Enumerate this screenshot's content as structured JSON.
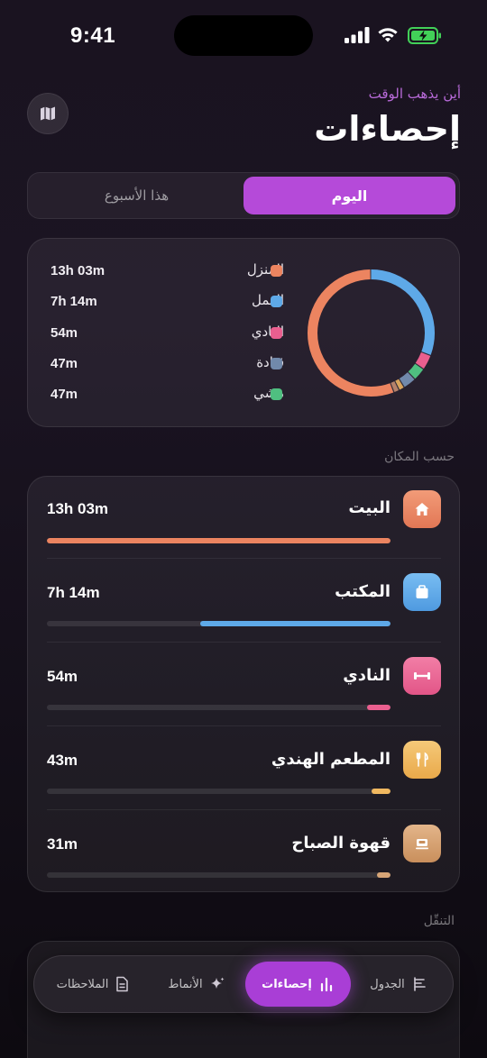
{
  "status_bar": {
    "time": "9:41"
  },
  "header": {
    "subtitle": "أين يذهب الوقت",
    "title": "إحصاءات",
    "map_icon": "map-icon"
  },
  "segmented": {
    "active": "اليوم",
    "inactive": "هذا الأسبوع"
  },
  "summary": {
    "items": [
      {
        "label": "المنزل",
        "value": "13h 03m",
        "color": "#ec8460"
      },
      {
        "label": "العمل",
        "value": "7h 14m",
        "color": "#5ea9e8"
      },
      {
        "label": "النادي",
        "value": "54m",
        "color": "#ea5f8f"
      },
      {
        "label": "قيادة",
        "value": "47m",
        "color": "#7189ab"
      },
      {
        "label": "مشي",
        "value": "47m",
        "color": "#4fbf80"
      }
    ]
  },
  "by_place": {
    "label": "حسب المكان",
    "items": [
      {
        "name": "البيت",
        "value": "13h 03m",
        "fraction": 1.0,
        "color": "#ec8460",
        "icon": "house-icon"
      },
      {
        "name": "المكتب",
        "value": "7h 14m",
        "fraction": 0.555,
        "color": "#5ea9e8",
        "icon": "briefcase-icon"
      },
      {
        "name": "النادي",
        "value": "54m",
        "fraction": 0.069,
        "color": "#ea5f8f",
        "icon": "dumbbell-icon"
      },
      {
        "name": "المطعم الهندي",
        "value": "43m",
        "fraction": 0.055,
        "color": "#f0b860",
        "icon": "utensils-icon"
      },
      {
        "name": "قهوة الصباح",
        "value": "31m",
        "fraction": 0.04,
        "color": "#d7a577",
        "icon": "coffee-icon"
      }
    ]
  },
  "travel": {
    "label": "التنقّل"
  },
  "tabs": [
    {
      "label": "الجدول",
      "icon": "timeline-icon",
      "active": false
    },
    {
      "label": "إحصاءات",
      "icon": "bar-chart-icon",
      "active": true
    },
    {
      "label": "الأنماط",
      "icon": "sparkle-icon",
      "active": false
    },
    {
      "label": "الملاحظات",
      "icon": "document-icon",
      "active": false
    }
  ]
}
